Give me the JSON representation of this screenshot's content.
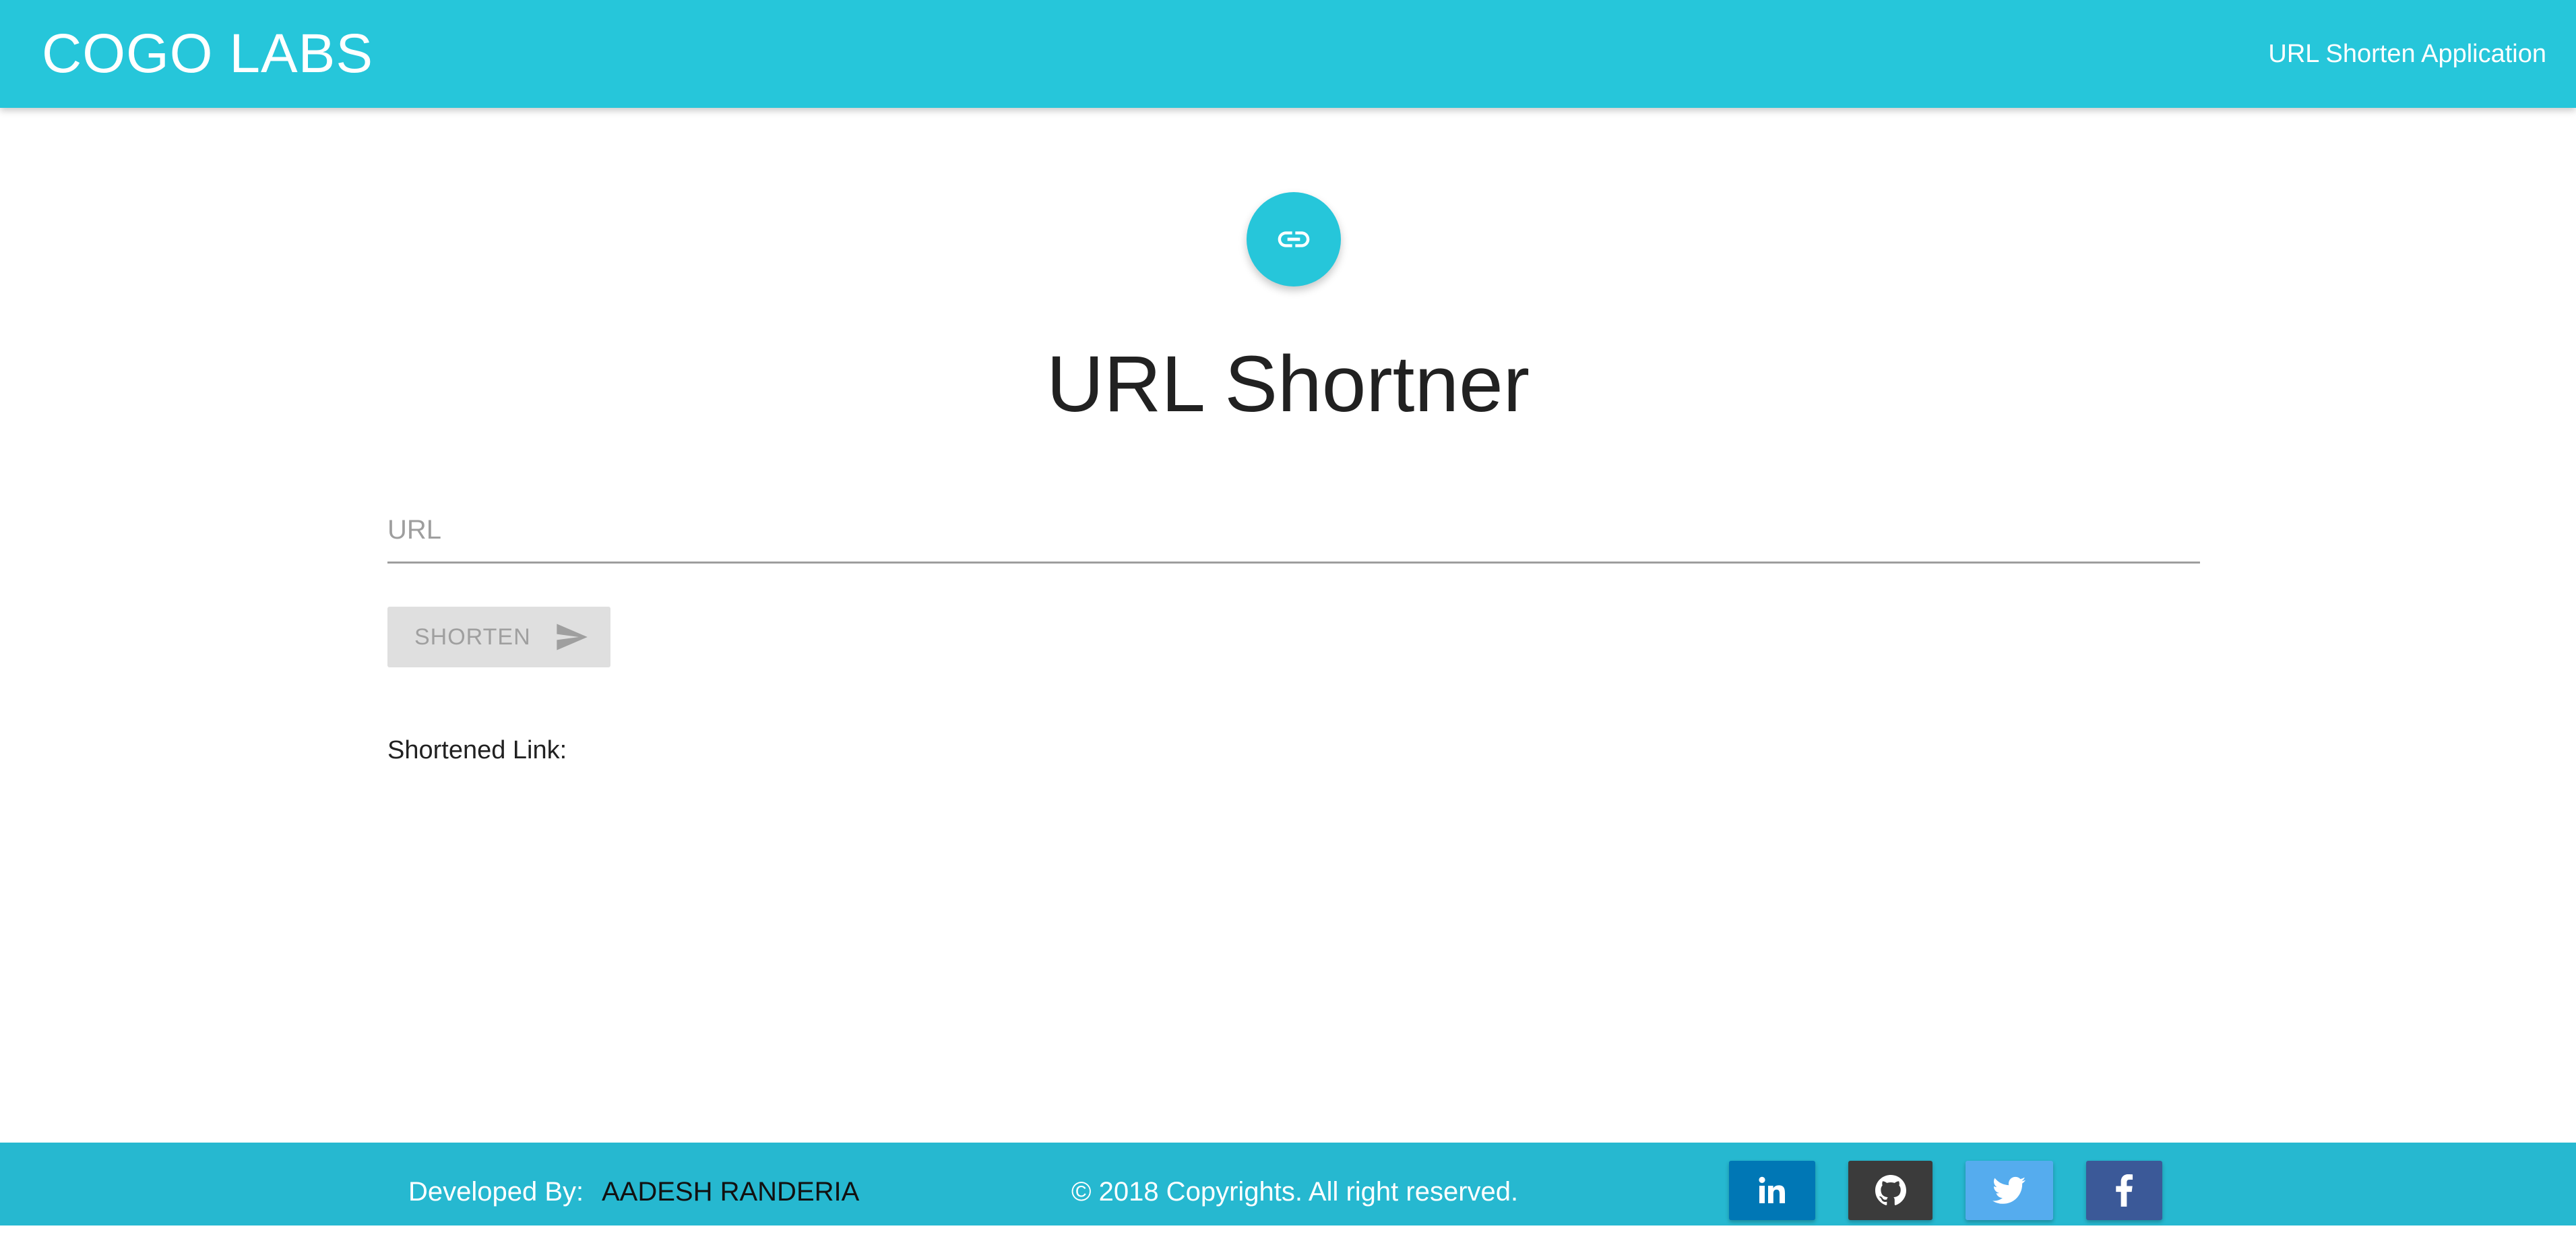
{
  "header": {
    "brand": "COGO LABS",
    "nav_right": "URL Shorten Application"
  },
  "main": {
    "logo_icon": "link-icon",
    "title": "URL Shortner",
    "url_input": {
      "placeholder": "URL",
      "value": ""
    },
    "shorten_button": {
      "label": "SHORTEN",
      "icon": "send-icon",
      "state": "disabled"
    },
    "result": {
      "label": "Shortened Link:",
      "value": ""
    }
  },
  "footer": {
    "developed_by_label": "Developed By:",
    "developer_name": "AADESH RANDERIA",
    "copyright": "© 2018 Copyrights. All right reserved.",
    "social": [
      {
        "name": "linkedin",
        "icon": "linkedin-icon",
        "color": "#0077b5"
      },
      {
        "name": "github",
        "icon": "github-icon",
        "color": "#3b3b3b"
      },
      {
        "name": "twitter",
        "icon": "twitter-icon",
        "color": "#55acee"
      },
      {
        "name": "facebook",
        "icon": "facebook-icon",
        "color": "#3b5998"
      }
    ]
  },
  "colors": {
    "primary": "#26c6da",
    "footer": "#26b8d0",
    "button_disabled_bg": "#dfdfdf",
    "button_disabled_text": "#9f9f9f"
  }
}
